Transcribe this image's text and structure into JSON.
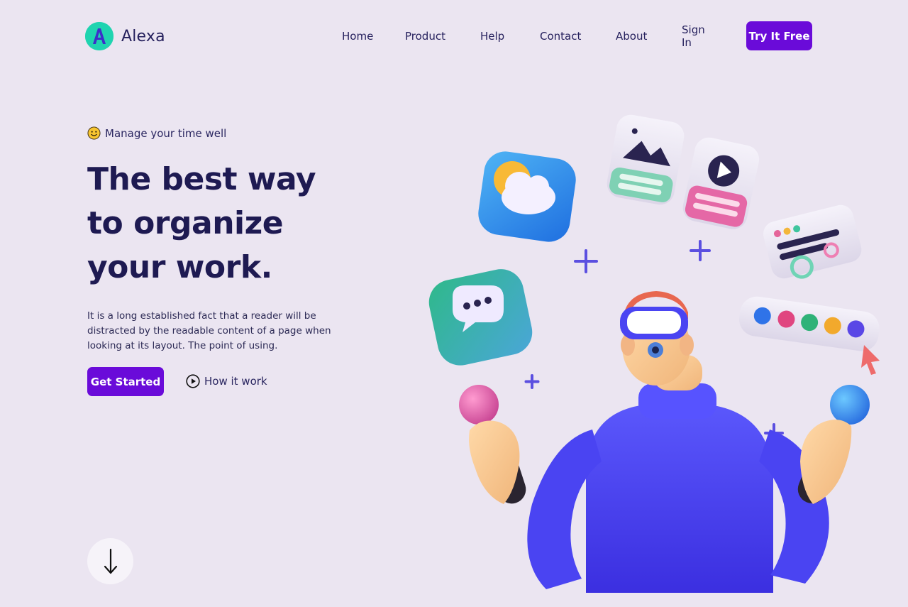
{
  "brand": {
    "name": "Alexa",
    "logo_letter": "A",
    "color": "#1fd4b0"
  },
  "nav": {
    "items": [
      "Home",
      "Product",
      "Help",
      "Contact",
      "About",
      "Sign In"
    ],
    "cta": "Try It Free"
  },
  "hero": {
    "tagline": "Manage your time well",
    "headline": [
      "The best way",
      "to organize",
      "your work."
    ],
    "description": "It is a long established fact that a reader will be distracted by the readable content of a page when looking at its layout. The point of using.",
    "primary_button": "Get Started",
    "secondary_button": "How it work"
  },
  "icons": {
    "smiley": "smiley-icon",
    "play": "play-circle-icon",
    "scroll": "arrow-down-icon"
  },
  "colors": {
    "background": "#ebe5f1",
    "accent": "#6a0bd9",
    "text": "#1e1a52"
  }
}
